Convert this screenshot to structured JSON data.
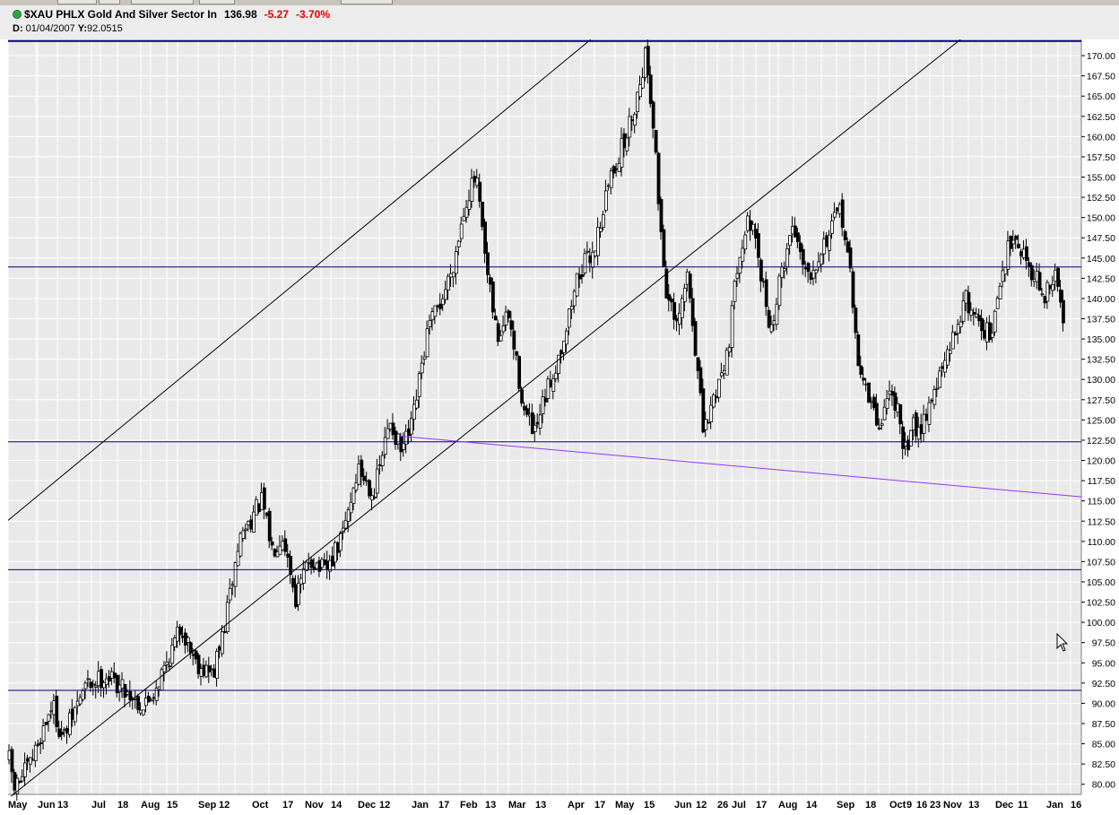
{
  "header": {
    "symbol": "$XAU PHLX Gold And Silver Sector In",
    "last": "136.98",
    "change": "-5.27",
    "change_pct": "-3.70%",
    "date_label": "D:",
    "date_value": "01/04/2007",
    "y_label": "Y:",
    "y_value": "92.0515"
  },
  "colors": {
    "bg": "#e9e9e9",
    "grid": "#ffffff",
    "candle": "#000000",
    "hline": "#000080",
    "trend": "#000000",
    "support": "#9933ff"
  },
  "chart_data": {
    "type": "candlestick",
    "ylim": [
      78.75,
      172.0
    ],
    "y_ticks": [
      80,
      82.5,
      85,
      87.5,
      90,
      92.5,
      95,
      97.5,
      100,
      102.5,
      105,
      107.5,
      110,
      112.5,
      115,
      117.5,
      120,
      122.5,
      125,
      127.5,
      130,
      132.5,
      135,
      137.5,
      140,
      142.5,
      145,
      147.5,
      150,
      152.5,
      155,
      157.5,
      160,
      162.5,
      165,
      167.5,
      170
    ],
    "y_tick_labels": [
      "80.00",
      "82.50",
      "85.00",
      "87.50",
      "90.00",
      "92.50",
      "95.00",
      "97.50",
      "100.00",
      "102.50",
      "105.00",
      "107.50",
      "110.00",
      "112.50",
      "115.00",
      "117.50",
      "120.00",
      "122.50",
      "125.00",
      "127.50",
      "130.00",
      "132.50",
      "135.00",
      "137.50",
      "140.00",
      "142.50",
      "145.00",
      "147.50",
      "150.00",
      "152.50",
      "155.00",
      "157.50",
      "160.00",
      "162.50",
      "165.00",
      "167.50",
      "170.00"
    ],
    "x_labels": [
      "May",
      "Jun",
      "13",
      "Jul",
      "18",
      "Aug",
      "15",
      "Sep",
      "12",
      "Oct",
      "17",
      "Nov",
      "14",
      "Dec",
      "12",
      "Jan",
      "17",
      "Feb",
      "13",
      "Mar",
      "13",
      "Apr",
      "17",
      "May",
      "15",
      "Jun",
      "12",
      "26",
      "Jul",
      "17",
      "Aug",
      "14",
      "Sep",
      "18",
      "Oct",
      "9",
      "16",
      "23",
      "Nov",
      "13",
      "Dec",
      "11",
      "Jan",
      "16"
    ],
    "horizontal_levels": [
      171.8,
      143.9,
      122.3,
      106.5,
      91.6
    ],
    "trendlines": [
      {
        "name": "upper-channel",
        "from": [
          0,
          112.6
        ],
        "to": [
          0.5429,
          172.0
        ]
      },
      {
        "name": "middle-channel",
        "from": [
          0.0025,
          78.5
        ],
        "to": [
          0.8874,
          172.0
        ]
      },
      {
        "name": "lower-support",
        "from": [
          0.3652,
          123.0
        ],
        "to": [
          1.0,
          115.5
        ]
      }
    ],
    "key_points": [
      {
        "t": 0.0,
        "value": 83.0
      },
      {
        "t": 0.005,
        "value": 79.5
      },
      {
        "t": 0.02,
        "value": 82.5
      },
      {
        "t": 0.04,
        "value": 90.0
      },
      {
        "t": 0.05,
        "value": 85.5
      },
      {
        "t": 0.07,
        "value": 92.0
      },
      {
        "t": 0.09,
        "value": 93.5
      },
      {
        "t": 0.11,
        "value": 91.5
      },
      {
        "t": 0.125,
        "value": 89.5
      },
      {
        "t": 0.135,
        "value": 91.5
      },
      {
        "t": 0.15,
        "value": 96.0
      },
      {
        "t": 0.16,
        "value": 99.5
      },
      {
        "t": 0.175,
        "value": 95.0
      },
      {
        "t": 0.19,
        "value": 93.5
      },
      {
        "t": 0.2,
        "value": 99.0
      },
      {
        "t": 0.215,
        "value": 110.5
      },
      {
        "t": 0.235,
        "value": 115.0
      },
      {
        "t": 0.245,
        "value": 109.0
      },
      {
        "t": 0.255,
        "value": 111.0
      },
      {
        "t": 0.267,
        "value": 103.0
      },
      {
        "t": 0.28,
        "value": 108.0
      },
      {
        "t": 0.295,
        "value": 106.0
      },
      {
        "t": 0.31,
        "value": 110.5
      },
      {
        "t": 0.325,
        "value": 119.0
      },
      {
        "t": 0.34,
        "value": 116.0
      },
      {
        "t": 0.355,
        "value": 125.0
      },
      {
        "t": 0.365,
        "value": 121.0
      },
      {
        "t": 0.375,
        "value": 124.0
      },
      {
        "t": 0.39,
        "value": 136.0
      },
      {
        "t": 0.405,
        "value": 140.5
      },
      {
        "t": 0.415,
        "value": 145.0
      },
      {
        "t": 0.425,
        "value": 152.0
      },
      {
        "t": 0.435,
        "value": 155.0
      },
      {
        "t": 0.445,
        "value": 143.0
      },
      {
        "t": 0.455,
        "value": 135.0
      },
      {
        "t": 0.465,
        "value": 138.0
      },
      {
        "t": 0.48,
        "value": 126.0
      },
      {
        "t": 0.49,
        "value": 123.0
      },
      {
        "t": 0.5,
        "value": 128.0
      },
      {
        "t": 0.51,
        "value": 132.0
      },
      {
        "t": 0.52,
        "value": 137.0
      },
      {
        "t": 0.53,
        "value": 143.0
      },
      {
        "t": 0.545,
        "value": 146.0
      },
      {
        "t": 0.56,
        "value": 155.0
      },
      {
        "t": 0.575,
        "value": 160.0
      },
      {
        "t": 0.585,
        "value": 165.0
      },
      {
        "t": 0.593,
        "value": 170.5
      },
      {
        "t": 0.6,
        "value": 162.0
      },
      {
        "t": 0.605,
        "value": 152.0
      },
      {
        "t": 0.612,
        "value": 141.0
      },
      {
        "t": 0.622,
        "value": 136.0
      },
      {
        "t": 0.632,
        "value": 143.0
      },
      {
        "t": 0.64,
        "value": 133.0
      },
      {
        "t": 0.647,
        "value": 123.0
      },
      {
        "t": 0.655,
        "value": 127.0
      },
      {
        "t": 0.67,
        "value": 134.0
      },
      {
        "t": 0.68,
        "value": 146.0
      },
      {
        "t": 0.69,
        "value": 150.0
      },
      {
        "t": 0.7,
        "value": 143.0
      },
      {
        "t": 0.71,
        "value": 136.0
      },
      {
        "t": 0.72,
        "value": 143.5
      },
      {
        "t": 0.73,
        "value": 149.0
      },
      {
        "t": 0.745,
        "value": 143.0
      },
      {
        "t": 0.76,
        "value": 147.0
      },
      {
        "t": 0.775,
        "value": 151.0
      },
      {
        "t": 0.782,
        "value": 145.0
      },
      {
        "t": 0.79,
        "value": 133.0
      },
      {
        "t": 0.8,
        "value": 128.0
      },
      {
        "t": 0.81,
        "value": 124.0
      },
      {
        "t": 0.82,
        "value": 128.5
      },
      {
        "t": 0.827,
        "value": 127.0
      },
      {
        "t": 0.833,
        "value": 120.0
      },
      {
        "t": 0.84,
        "value": 124.0
      },
      {
        "t": 0.85,
        "value": 124.5
      },
      {
        "t": 0.86,
        "value": 128.0
      },
      {
        "t": 0.875,
        "value": 133.0
      },
      {
        "t": 0.89,
        "value": 140.0
      },
      {
        "t": 0.905,
        "value": 137.0
      },
      {
        "t": 0.915,
        "value": 135.0
      },
      {
        "t": 0.925,
        "value": 143.0
      },
      {
        "t": 0.935,
        "value": 148.5
      },
      {
        "t": 0.945,
        "value": 145.5
      },
      {
        "t": 0.955,
        "value": 143.0
      },
      {
        "t": 0.965,
        "value": 140.0
      },
      {
        "t": 0.975,
        "value": 143.0
      },
      {
        "t": 0.982,
        "value": 136.98
      }
    ]
  }
}
